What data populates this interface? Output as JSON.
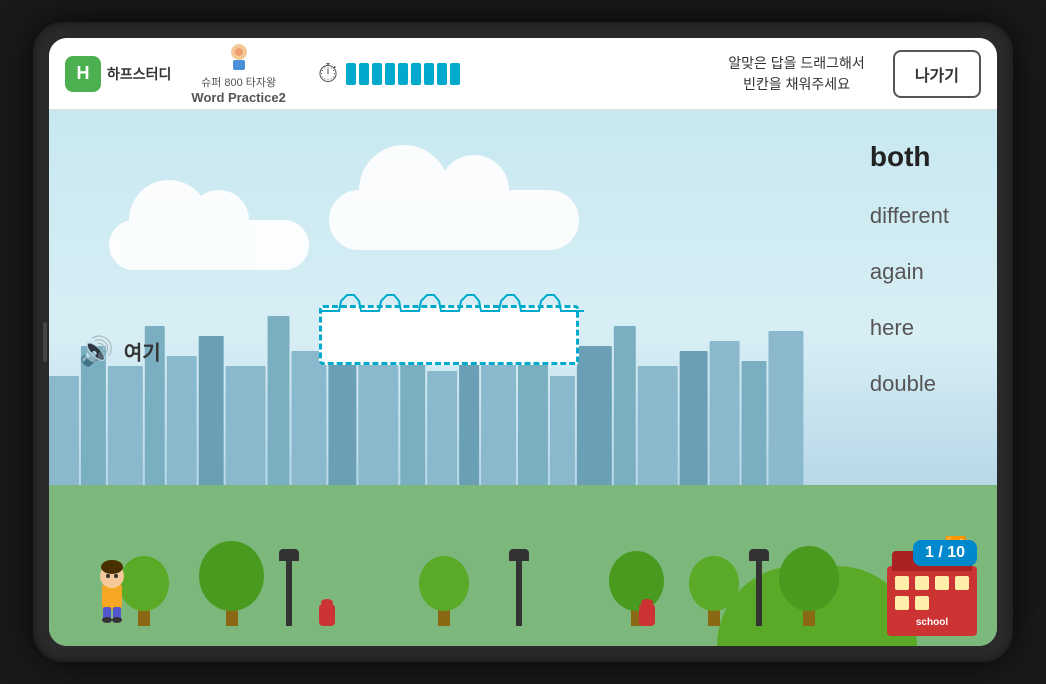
{
  "header": {
    "logo_icon": "H",
    "logo_text": "하프스터디",
    "character_label": "슈퍼 800 타자왕",
    "subtitle": "Word Practice2",
    "instruction_line1": "알맞은 답을 드래그해서",
    "instruction_line2": "빈칸을 채워주세요",
    "exit_button": "나가기",
    "timer_segments": 9
  },
  "game": {
    "speaker_label": "여기",
    "words": [
      {
        "text": "both",
        "index": 0
      },
      {
        "text": "different",
        "index": 1
      },
      {
        "text": "again",
        "index": 2
      },
      {
        "text": "here",
        "index": 3
      },
      {
        "text": "double",
        "index": 4
      }
    ],
    "progress": "1 / 10",
    "school_label": "school"
  }
}
